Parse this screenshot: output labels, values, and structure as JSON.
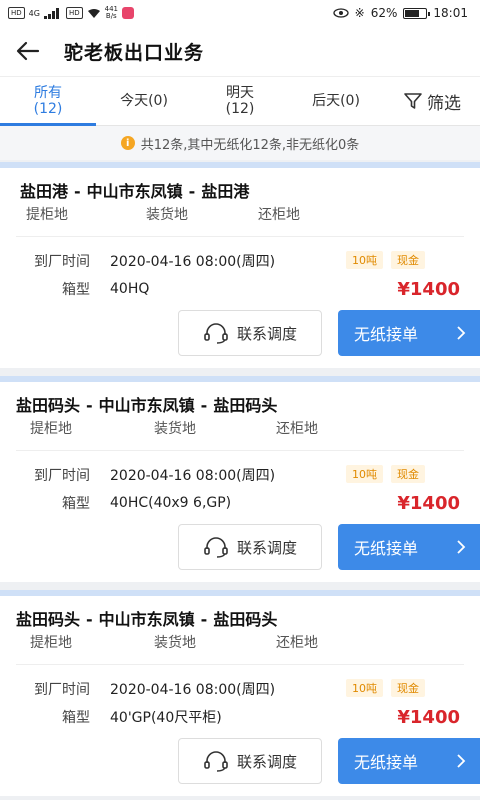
{
  "status": {
    "left_chips": [
      "HD",
      "HD"
    ],
    "signal": "4G",
    "net_speed_value": "441",
    "net_speed_unit": "B/s",
    "battery": "62%",
    "battery_level": 0.62,
    "time": "18:01"
  },
  "header": {
    "title": "驼老板出口业务"
  },
  "tabs": [
    {
      "label": "所有",
      "count": "(12)"
    },
    {
      "label": "今天(0)",
      "count": ""
    },
    {
      "label": "明天",
      "count": "(12)"
    },
    {
      "label": "后天(0)",
      "count": ""
    }
  ],
  "filter_label": "筛选",
  "notice": "共12条,其中无纸化12条,非无纸化0条",
  "orders": [
    {
      "pickup": "盐田港",
      "loading": "中山市东凤镇",
      "return": "盐田港",
      "pickup_label": "提柜地",
      "loading_label": "装货地",
      "return_label": "还柜地",
      "arrival_label": "到厂时间",
      "arrival": "2020-04-16 08:00(周四)",
      "box_label": "箱型",
      "box": "40HQ",
      "weight": "10吨",
      "payment": "现金",
      "price": "¥1400",
      "contact_label": "联系调度",
      "accept_label": "无纸接单"
    },
    {
      "pickup": "盐田码头",
      "loading": "中山市东凤镇",
      "return": "盐田码头",
      "pickup_label": "提柜地",
      "loading_label": "装货地",
      "return_label": "还柜地",
      "arrival_label": "到厂时间",
      "arrival": "2020-04-16 08:00(周四)",
      "box_label": "箱型",
      "box": "40HC(40x9 6,GP)",
      "weight": "10吨",
      "payment": "现金",
      "price": "¥1400",
      "contact_label": "联系调度",
      "accept_label": "无纸接单"
    },
    {
      "pickup": "盐田码头",
      "loading": "中山市东凤镇",
      "return": "盐田码头",
      "pickup_label": "提柜地",
      "loading_label": "装货地",
      "return_label": "还柜地",
      "arrival_label": "到厂时间",
      "arrival": "2020-04-16 08:00(周四)",
      "box_label": "箱型",
      "box": "40'GP(40尺平柜)",
      "weight": "10吨",
      "payment": "现金",
      "price": "¥1400",
      "contact_label": "联系调度",
      "accept_label": "无纸接单"
    }
  ],
  "colors": {
    "accent": "#2e7ce0",
    "button": "#3d8ae8",
    "price": "#d9252b",
    "tag": "#e08a00",
    "card_top": "#cfe0f7"
  }
}
